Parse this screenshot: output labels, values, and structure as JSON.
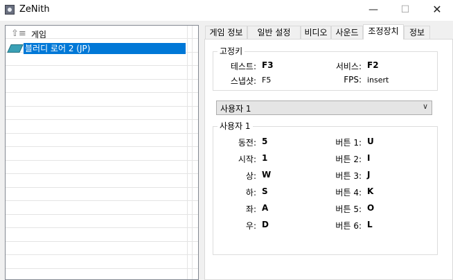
{
  "window": {
    "title": "ZeNith",
    "minimize": "—",
    "maximize": "☐",
    "close": "✕"
  },
  "tree": {
    "root_label": "게임",
    "items": [
      {
        "label": "블러디 로어 2 (JP)",
        "selected": true
      }
    ]
  },
  "tabs": [
    {
      "label": "게임 정보",
      "active": false
    },
    {
      "label": "일반 설정",
      "active": false
    },
    {
      "label": "비디오",
      "active": false
    },
    {
      "label": "사운드",
      "active": false
    },
    {
      "label": "조정장치",
      "active": true
    },
    {
      "label": "정보",
      "active": false
    }
  ],
  "hotkeys": {
    "title": "고정키",
    "test_label": "테스트:",
    "test_value": "F3",
    "service_label": "서비스:",
    "service_value": "F2",
    "snapshot_label": "스냅샷:",
    "snapshot_value": "F5",
    "fps_label": "FPS:",
    "fps_value": "insert"
  },
  "player_select": {
    "value": "사용자 1"
  },
  "player": {
    "title": "사용자 1",
    "left": [
      {
        "label": "동전:",
        "value": "5"
      },
      {
        "label": "시작:",
        "value": "1"
      },
      {
        "label": "상:",
        "value": "W"
      },
      {
        "label": "하:",
        "value": "S"
      },
      {
        "label": "좌:",
        "value": "A"
      },
      {
        "label": "우:",
        "value": "D"
      }
    ],
    "right": [
      {
        "label": "버튼 1:",
        "value": "U"
      },
      {
        "label": "버튼 2:",
        "value": "I"
      },
      {
        "label": "버튼 3:",
        "value": "J"
      },
      {
        "label": "버튼 4:",
        "value": "K"
      },
      {
        "label": "버튼 5:",
        "value": "O"
      },
      {
        "label": "버튼 6:",
        "value": "L"
      }
    ]
  },
  "colors": {
    "selection": "#0078d7",
    "window_bg": "#f0f0f0",
    "panel_bg": "#ffffff"
  }
}
